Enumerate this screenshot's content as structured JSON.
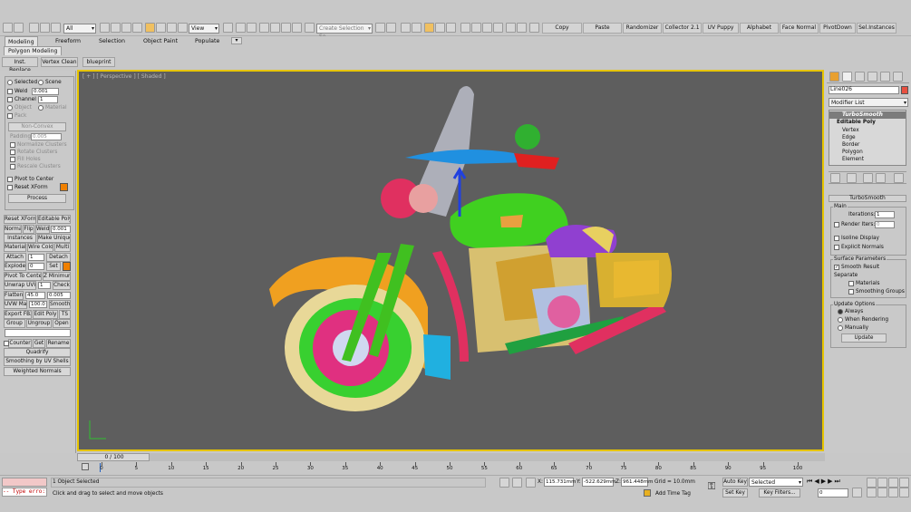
{
  "toolbar": {
    "filter_value": "All",
    "view_value": "View",
    "selection_set_placeholder": "Create Selection Se",
    "scripts": [
      "Copy",
      "Paste",
      "Randomizer",
      "Collector 2.1",
      "UV Puppy",
      "Alphabet",
      "Face Normal",
      "PivotDown",
      "Sel.Instances"
    ]
  },
  "ribbon": {
    "tabs": [
      "Modeling",
      "Freeform",
      "Selection",
      "Object Paint",
      "Populate"
    ],
    "active_tab": "Modeling",
    "sub_tab": "Polygon Modeling"
  },
  "row3": {
    "buttons": [
      "Inst. Replace",
      "Vertex Clean",
      "blueprint"
    ]
  },
  "left_panel": {
    "selected": "Selected",
    "scene": "Scene",
    "weld": "Weld",
    "weld_value": "0.001",
    "channel": "Channel",
    "channel_value": "1",
    "object": "Object",
    "material": "Material",
    "pack": "Pack",
    "non_convex": "Non-Convex",
    "padding": "Padding",
    "padding_value": "0.005",
    "normalize": "Normalize Clusters",
    "rotate": "Rotate Clusters",
    "fill_holes": "Fill Holes",
    "rescale": "Rescale Clusters",
    "pivot_to_center": "Pivot to Center",
    "reset_xform": "Reset XForm",
    "process": "Process",
    "grid_rows": [
      [
        "Reset XForm",
        "Editable Poly"
      ],
      [
        "Normal",
        "Flip",
        "Weld",
        "0.001"
      ],
      [
        "Instances",
        "Make Unique"
      ],
      [
        "Material",
        "Wire Color",
        "Multi"
      ],
      [
        "Attach",
        "1",
        "Detach"
      ],
      [
        "Explode",
        "0",
        "Set"
      ],
      [
        "Pivot To Center",
        "Z Minimum"
      ],
      [
        "Unwrap UVW",
        "1",
        "Check"
      ],
      [
        "Flatten",
        "45.0",
        "0.005"
      ],
      [
        "UVW Map",
        "100.0",
        "Smooth"
      ],
      [
        "Export FBX",
        "Edit Poly",
        "TS"
      ],
      [
        "Group",
        "Ungroup",
        "Open"
      ],
      [
        "Counter",
        "Get",
        "Rename"
      ],
      [
        "Quadrify"
      ],
      [
        "Smoothing by UV Shells"
      ],
      [
        "Weighted Normals"
      ]
    ]
  },
  "viewport": {
    "label": "[ + ] [ Perspective ] [ Shaded ]"
  },
  "right_panel": {
    "object_name": "Line026",
    "modifier_list": "Modifier List",
    "stack": [
      "TurboSmooth",
      "Editable Poly",
      "Vertex",
      "Edge",
      "Border",
      "Polygon",
      "Element"
    ],
    "rollout_title": "TurboSmooth",
    "main_label": "Main",
    "iterations_label": "Iterations:",
    "iterations_value": "1",
    "render_iters_label": "Render Iters:",
    "render_iters_value": "0",
    "isoline": "Isoline Display",
    "explicit": "Explicit Normals",
    "surface_params": "Surface Parameters",
    "smooth_result": "Smooth Result",
    "separate": "Separate",
    "materials": "Materials",
    "smoothing_groups": "Smoothing Groups",
    "update_options": "Update Options",
    "always": "Always",
    "when_rendering": "When Rendering",
    "manually": "Manually",
    "update_button": "Update"
  },
  "timeline": {
    "frame": "0 / 100",
    "ticks": [
      "0",
      "5",
      "10",
      "15",
      "20",
      "25",
      "30",
      "35",
      "40",
      "45",
      "50",
      "55",
      "60",
      "65",
      "70",
      "75",
      "80",
      "85",
      "90",
      "95",
      "100"
    ]
  },
  "status": {
    "script_error": "-- Type erro:",
    "selection": "1 Object Selected",
    "hint": "Click and drag to select and move objects",
    "x": "115.731mm",
    "y": "-522.629mm",
    "z": "961.448mm",
    "grid": "Grid = 10.0mm",
    "add_time_tag": "Add Time Tag",
    "auto_key": "Auto Key",
    "selected": "Selected",
    "set_key": "Set Key",
    "key_filters": "Key Filters...",
    "frame_value": "0"
  },
  "colors": {
    "accent": "#e6c400",
    "viewport_bg": "#5e5e5e",
    "panel_bg": "#c8c8c8"
  }
}
